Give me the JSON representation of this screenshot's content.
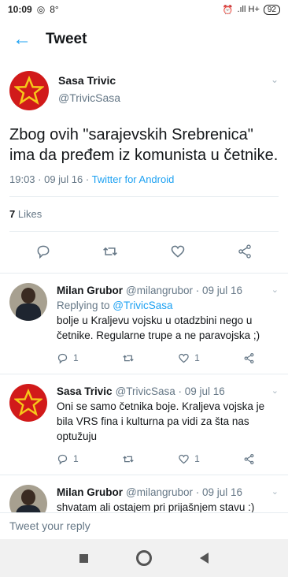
{
  "status": {
    "time": "10:09",
    "temp": "8°",
    "network": ".ıll H+",
    "battery": "92"
  },
  "header": {
    "title": "Tweet"
  },
  "main_tweet": {
    "name": "Sasa Trivic",
    "handle": "@TrivicSasa",
    "text": "Zbog ovih \"sarajevskih Srebrenica\" ima da pređem iz komunista u četnike.",
    "time": "19:03 · 09 jul 16 · ",
    "source": "Twitter for Android",
    "likes_count": "7",
    "likes_label": " Likes"
  },
  "replies": [
    {
      "name": "Milan Grubor",
      "handle": "@milangrubor · 09 jul 16",
      "replying_prefix": "Replying to ",
      "replying_to": "@TrivicSasa",
      "text": "bolje u Kraljevu vojsku u otadzbini nego u četnike. Regularne trupe a ne paravojska ;)",
      "reply_count": "1",
      "like_count": "1"
    },
    {
      "name": "Sasa Trivic",
      "handle": "@TrivicSasa · 09 jul 16",
      "text": "Oni se samo četnika boje. Kraljeva vojska je bila VRS  fina i kulturna pa vidi za šta nas optužuju",
      "reply_count": "1",
      "like_count": "1"
    },
    {
      "name": "Milan Grubor",
      "handle": "@milangrubor · 09 jul 16",
      "text": "shvatam ali ostajem pri prijašnjem stavu :)"
    }
  ],
  "compose": {
    "placeholder": "Tweet your reply"
  },
  "colors": {
    "accent": "#1da1f2",
    "star_bg": "#d11a1a",
    "star": "#f6c81a"
  }
}
